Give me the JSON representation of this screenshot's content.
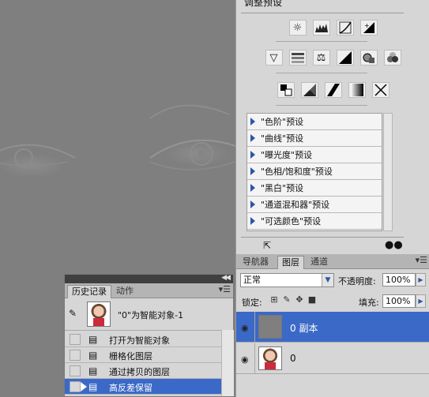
{
  "canvas": {
    "description_icon": "high-pass-image"
  },
  "adjustments": {
    "panel_title": "调整预设",
    "row1_icons": [
      "brightness-contrast-icon",
      "levels-icon",
      "curves-icon",
      "exposure-icon"
    ],
    "row2_icons": [
      "vibrance-icon",
      "hue-saturation-icon",
      "color-balance-icon",
      "black-white-icon",
      "photo-filter-icon",
      "channel-mixer-icon"
    ],
    "row3_icons": [
      "invert-icon",
      "posterize-icon",
      "threshold-icon",
      "gradient-map-icon",
      "selective-color-icon"
    ],
    "presets": [
      "\"色阶\"预设",
      "\"曲线\"预设",
      "\"曝光度\"预设",
      "\"色相/饱和度\"预设",
      "\"黑白\"预设",
      "\"通道混和器\"预设",
      "\"可选颜色\"预设"
    ]
  },
  "layers": {
    "tabs": [
      "导航器",
      "图层",
      "通道"
    ],
    "active_tab": "图层",
    "blend_mode": "正常",
    "opacity_label": "不透明度:",
    "opacity_value": "100%",
    "lock_label": "锁定:",
    "fill_label": "填充:",
    "fill_value": "100%",
    "items": [
      {
        "name": "0 副本",
        "selected": true
      },
      {
        "name": "0",
        "selected": false
      }
    ]
  },
  "history": {
    "tabs": [
      "历史记录",
      "动作"
    ],
    "active_tab": "历史记录",
    "snapshot_name": "\"0\"为智能对象-1",
    "steps": [
      {
        "label": "打开为智能对象",
        "selected": false
      },
      {
        "label": "栅格化图层",
        "selected": false
      },
      {
        "label": "通过拷贝的图层",
        "selected": false
      },
      {
        "label": "高反差保留",
        "selected": true
      }
    ]
  },
  "colors": {
    "accent": "#3b69c7",
    "panel_bg": "#d6d6d6",
    "canvas_grey": "#7f7f7f"
  }
}
